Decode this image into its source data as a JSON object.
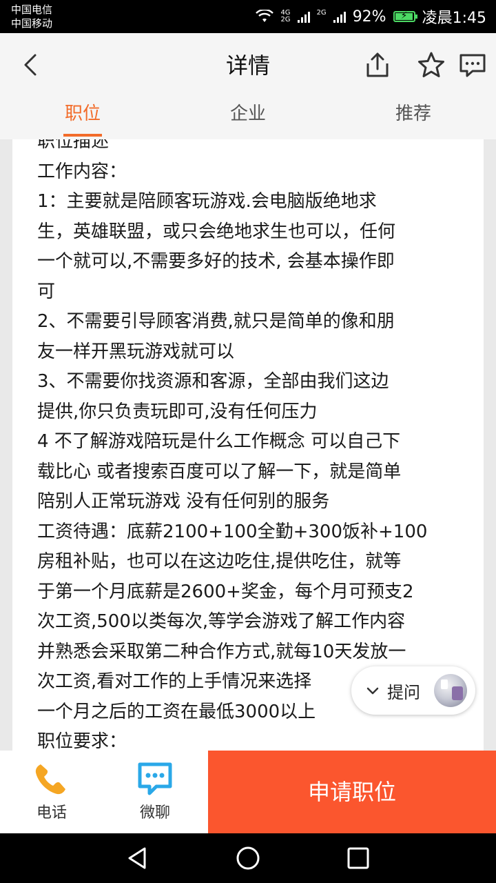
{
  "status_bar": {
    "carrier1": "中国电信",
    "carrier2": "中国移动",
    "net1": "4G",
    "net1b": "2G",
    "net2": "2G",
    "battery": "92%",
    "time": "凌晨1:45"
  },
  "header": {
    "title": "详情"
  },
  "tabs": [
    {
      "label": "职位",
      "active": true
    },
    {
      "label": "企业",
      "active": false
    },
    {
      "label": "推荐",
      "active": false
    }
  ],
  "content": {
    "lines": [
      "职位描述",
      "工作内容：",
      "1：主要就是陪顾客玩游戏.会电脑版绝地求",
      "生，英雄联盟，或只会绝地求生也可以，任何",
      "一个就可以,不需要多好的技术, 会基本操作即",
      "可",
      "2、不需要引导顾客消费,就只是简单的像和朋",
      "友一样开黑玩游戏就可以",
      "3、不需要你找资源和客源，全部由我们这边",
      "提供,你只负责玩即可,没有任何压力",
      "4 不了解游戏陪玩是什么工作概念 可以自己下",
      "载比心 或者搜索百度可以了解一下，就是简单",
      "陪别人正常玩游戏 没有任何别的服务",
      "工资待遇：底薪2100+100全勤+300饭补+100",
      "房租补贴，也可以在这边吃住,提供吃住，就等",
      "于第一个月底薪是2600+奖金，每个月可预支2",
      "次工资,500以类每次,等学会游戏了解工作内容",
      "并熟悉会采取第二种合作方式,就每10天发放一",
      "次工资,看对工作的上手情况来选择",
      "一个月之后的工资在最低3000以上",
      "职位要求："
    ]
  },
  "ask_button": {
    "label": "提问"
  },
  "bottom_bar": {
    "phone_label": "电话",
    "chat_label": "微聊",
    "apply_label": "申请职位"
  },
  "colors": {
    "accent": "#f26c2a",
    "apply": "#fb562e",
    "phone_icon": "#f5a623",
    "chat_icon": "#2aa8e8"
  }
}
